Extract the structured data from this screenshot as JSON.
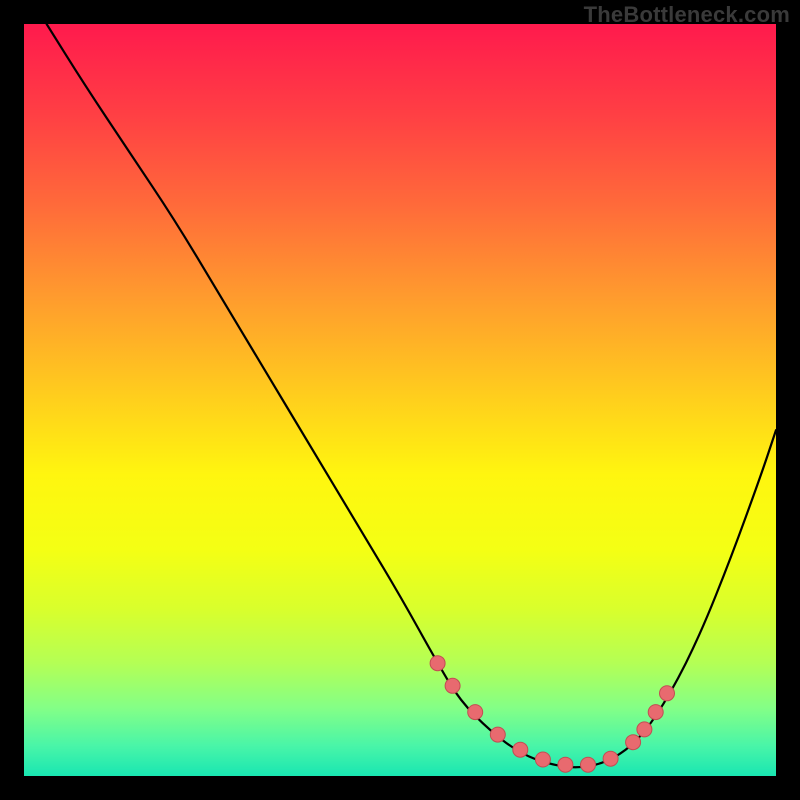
{
  "watermark": "TheBottleneck.com",
  "chart_data": {
    "type": "line",
    "title": "",
    "xlabel": "",
    "ylabel": "",
    "xlim": [
      0,
      100
    ],
    "ylim": [
      0,
      100
    ],
    "grid": false,
    "series": [
      {
        "name": "curve",
        "x": [
          3,
          8,
          14,
          20,
          26,
          32,
          38,
          44,
          50,
          55,
          58,
          62,
          66,
          70,
          74,
          78,
          82,
          86,
          90,
          94,
          98,
          100
        ],
        "values": [
          100,
          92,
          83,
          74,
          64,
          54,
          44,
          34,
          24,
          15,
          10,
          6,
          3,
          1.5,
          1,
          2,
          5,
          11,
          19,
          29,
          40,
          46
        ]
      }
    ],
    "markers": {
      "name": "dots",
      "x": [
        55,
        57,
        60,
        63,
        66,
        69,
        72,
        75,
        78,
        81,
        82.5,
        84,
        85.5
      ],
      "values": [
        15,
        12,
        8.5,
        5.5,
        3.5,
        2.2,
        1.5,
        1.5,
        2.3,
        4.5,
        6.2,
        8.5,
        11
      ]
    }
  }
}
